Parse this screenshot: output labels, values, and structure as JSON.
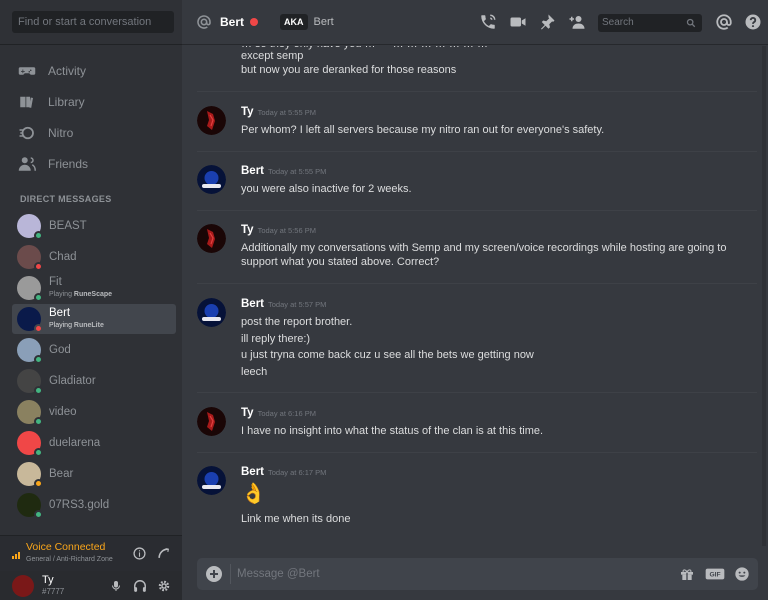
{
  "sidebar": {
    "search_placeholder": "Find or start a conversation",
    "nav": [
      {
        "label": "Activity",
        "icon": "gamepad-icon"
      },
      {
        "label": "Library",
        "icon": "library-icon"
      },
      {
        "label": "Nitro",
        "icon": "nitro-icon"
      },
      {
        "label": "Friends",
        "icon": "friends-icon"
      }
    ],
    "dm_header": "DIRECT MESSAGES",
    "dms": [
      {
        "name": "BEAST",
        "activity": "",
        "activity_bold": "",
        "status": "#43b581",
        "avatar": "#b9b6d8"
      },
      {
        "name": "Chad",
        "activity": "",
        "activity_bold": "",
        "status": "#f04747",
        "avatar": "#6b4b4b"
      },
      {
        "name": "Fit",
        "activity": "Playing ",
        "activity_bold": "RuneScape",
        "status": "#43b581",
        "avatar": "#9a9a9a"
      },
      {
        "name": "Bert",
        "activity": "Playing ",
        "activity_bold": "RuneLite",
        "status": "#f04747",
        "avatar": "#0a1a4a"
      },
      {
        "name": "God",
        "activity": "",
        "activity_bold": "",
        "status": "#43b581",
        "avatar": "#8a9fb8"
      },
      {
        "name": "Gladiator",
        "activity": "",
        "activity_bold": "",
        "status": "#43b581",
        "avatar": "#444"
      },
      {
        "name": "video",
        "activity": "",
        "activity_bold": "",
        "status": "#43b581",
        "avatar": "#8a8160"
      },
      {
        "name": "duelarena",
        "activity": "",
        "activity_bold": "",
        "status": "#43b581",
        "avatar": "#f04747"
      },
      {
        "name": "Bear",
        "activity": "",
        "activity_bold": "",
        "status": "#faa61a",
        "avatar": "#c8b89a"
      },
      {
        "name": "07RS3.gold",
        "activity": "",
        "activity_bold": "",
        "status": "#43b581",
        "avatar": "#1f2a10"
      }
    ],
    "voice": {
      "title": "Voice Connected",
      "channel": "General / Anti-Richard Zone",
      "color": "#faa61a"
    },
    "user": {
      "name": "Ty",
      "tag": "#7777"
    }
  },
  "header": {
    "name": "Bert",
    "aka_badge": "AKA",
    "aka_name": "Bert",
    "search_placeholder": "Search",
    "icons": [
      "call-icon",
      "video-icon",
      "pin-icon",
      "add-member-icon",
      "mention-icon",
      "help-icon"
    ]
  },
  "messages": [
    {
      "author": "",
      "time": "",
      "lines": [
        "except semp",
        "but now you are deranked for those reasons"
      ],
      "partial": true
    },
    {
      "author": "Ty",
      "time": "Today at 5:55 PM",
      "lines": [
        "Per whom? I left all servers because my nitro ran out for everyone's safety."
      ]
    },
    {
      "author": "Bert",
      "time": "Today at 5:55 PM",
      "lines": [
        "you were also inactive for 2 weeks."
      ]
    },
    {
      "author": "Ty",
      "time": "Today at 5:56 PM",
      "lines": [
        "Additionally my conversations with Semp and my screen/voice recordings while hosting are going to",
        "support what you stated above. Correct?"
      ]
    },
    {
      "author": "Bert",
      "time": "Today at 5:57 PM",
      "lines": [
        "post the report brother.",
        "ill reply there:)",
        "u just tryna come back cuz u see all the bets we getting now",
        "leech"
      ]
    },
    {
      "author": "Ty",
      "time": "Today at 6:16 PM",
      "lines": [
        "I have no insight into what the status of the clan is at this time."
      ]
    },
    {
      "author": "Bert",
      "time": "Today at 6:17 PM",
      "emoji": "👌",
      "lines": [
        "Link me when its done"
      ]
    }
  ],
  "composer": {
    "placeholder": "Message @Bert"
  },
  "colors": {
    "online": "#43b581",
    "dnd": "#f04747",
    "idle": "#faa61a",
    "background": "#36393f",
    "sidebar": "#2f3136"
  }
}
